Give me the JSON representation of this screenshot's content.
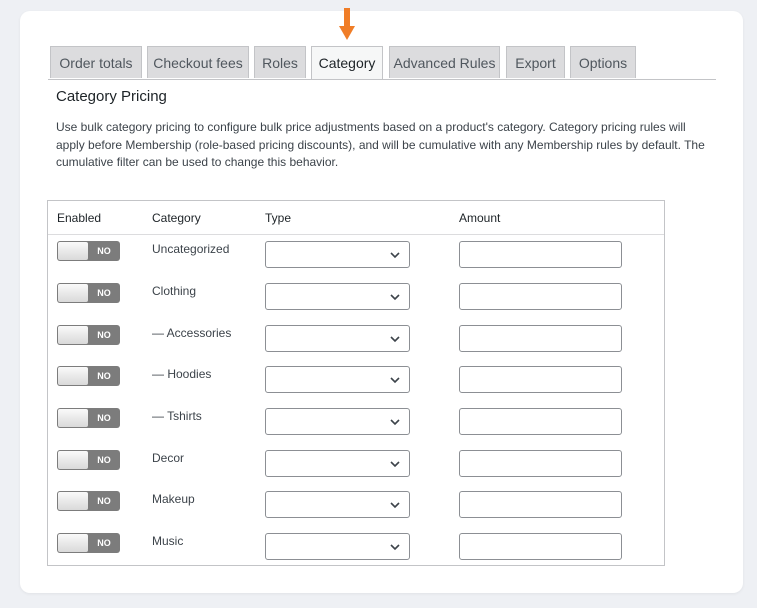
{
  "tabs": [
    {
      "label": "Order totals",
      "active": false
    },
    {
      "label": "Checkout fees",
      "active": false
    },
    {
      "label": "Roles",
      "active": false
    },
    {
      "label": "Category",
      "active": true
    },
    {
      "label": "Advanced Rules",
      "active": false
    },
    {
      "label": "Export",
      "active": false
    },
    {
      "label": "Options",
      "active": false
    }
  ],
  "indicator_icon": "down-arrow-icon",
  "accent_color": "#f07d27",
  "section": {
    "title": "Category Pricing",
    "description": "Use bulk category pricing to configure bulk price adjustments based on a product's category. Category pricing rules will apply before Membership (role-based pricing discounts), and will be cumulative with any Membership rules by default. The cumulative filter can be used to change this behavior."
  },
  "table": {
    "headers": {
      "enabled": "Enabled",
      "category": "Category",
      "type": "Type",
      "amount": "Amount"
    },
    "rows": [
      {
        "toggle": "NO",
        "category": "Uncategorized",
        "type": "",
        "amount": ""
      },
      {
        "toggle": "NO",
        "category": "Clothing",
        "type": "",
        "amount": ""
      },
      {
        "toggle": "NO",
        "category": "— Accessories",
        "type": "",
        "amount": ""
      },
      {
        "toggle": "NO",
        "category": "— Hoodies",
        "type": "",
        "amount": ""
      },
      {
        "toggle": "NO",
        "category": "— Tshirts",
        "type": "",
        "amount": ""
      },
      {
        "toggle": "NO",
        "category": "Decor",
        "type": "",
        "amount": ""
      },
      {
        "toggle": "NO",
        "category": "Makeup",
        "type": "",
        "amount": ""
      },
      {
        "toggle": "NO",
        "category": "Music",
        "type": "",
        "amount": ""
      }
    ]
  }
}
